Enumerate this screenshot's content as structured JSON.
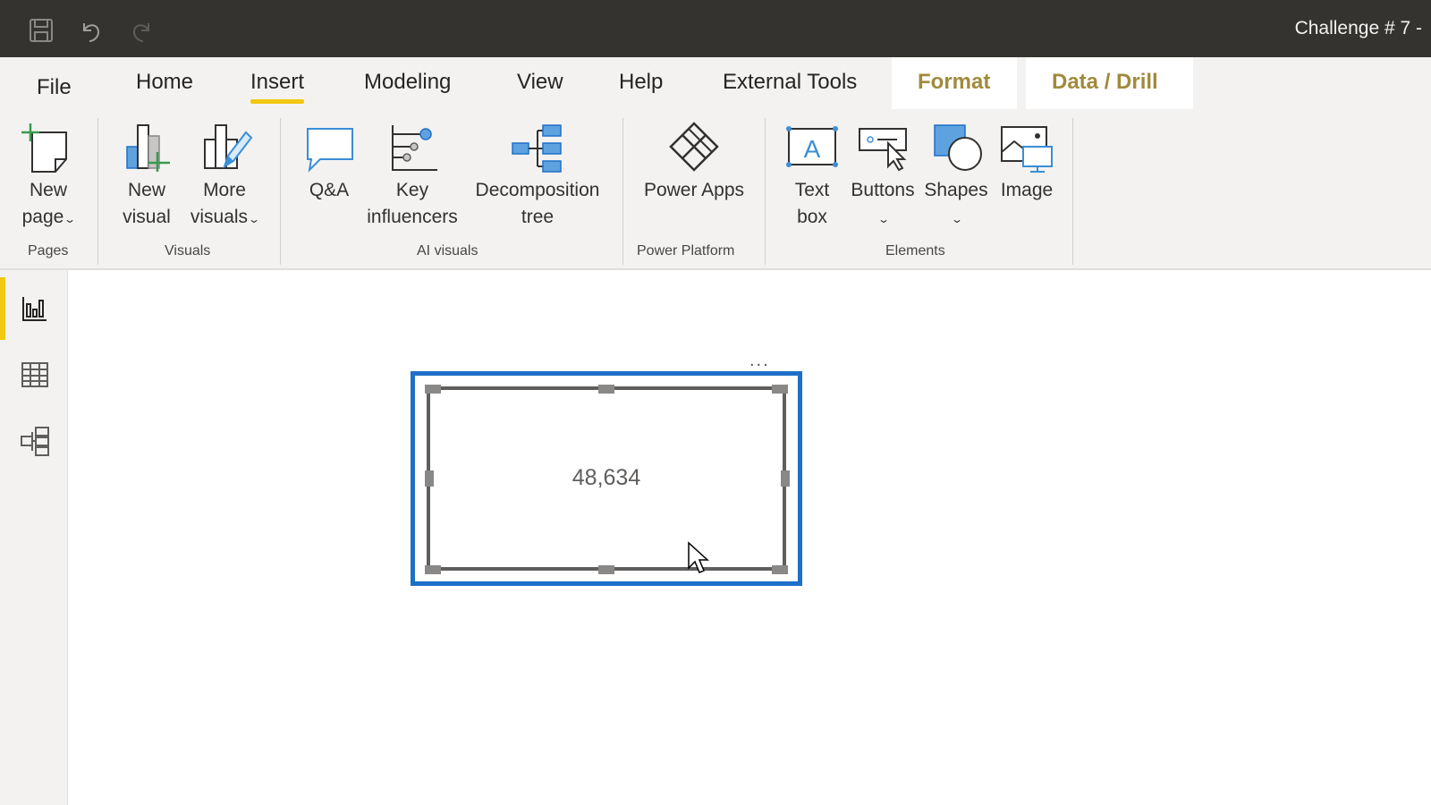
{
  "titlebar": {
    "title": "Challenge # 7 -",
    "quick_access": [
      {
        "name": "save-icon"
      },
      {
        "name": "undo-icon"
      },
      {
        "name": "redo-icon"
      }
    ]
  },
  "tabs": [
    {
      "label": "File"
    },
    {
      "label": "Home"
    },
    {
      "label": "Insert",
      "active": true
    },
    {
      "label": "Modeling"
    },
    {
      "label": "View"
    },
    {
      "label": "Help"
    },
    {
      "label": "External Tools"
    },
    {
      "label": "Format",
      "contextual": true
    },
    {
      "label": "Data / Drill",
      "contextual": true
    }
  ],
  "ribbon": {
    "groups": [
      {
        "label": "Pages",
        "buttons": [
          {
            "line1": "New",
            "line2": "page",
            "dropdown": true,
            "icon": "new-page-icon"
          }
        ]
      },
      {
        "label": "Visuals",
        "buttons": [
          {
            "line1": "New",
            "line2": "visual",
            "icon": "new-visual-icon"
          },
          {
            "line1": "More",
            "line2": "visuals",
            "dropdown": true,
            "icon": "more-visuals-icon"
          }
        ]
      },
      {
        "label": "AI visuals",
        "buttons": [
          {
            "line1": "Q&A",
            "line2": "",
            "icon": "qna-icon"
          },
          {
            "line1": "Key",
            "line2": "influencers",
            "icon": "key-influencers-icon"
          },
          {
            "line1": "Decomposition",
            "line2": "tree",
            "icon": "decomposition-tree-icon"
          }
        ]
      },
      {
        "label": "Power Platform",
        "buttons": [
          {
            "line1": "Power Apps",
            "line2": "",
            "icon": "power-apps-icon"
          }
        ]
      },
      {
        "label": "Elements",
        "buttons": [
          {
            "line1": "Text",
            "line2": "box",
            "icon": "text-box-icon"
          },
          {
            "line1": "Buttons",
            "line2": "",
            "dropdown": true,
            "icon": "buttons-icon"
          },
          {
            "line1": "Shapes",
            "line2": "",
            "dropdown": true,
            "icon": "shapes-icon"
          },
          {
            "line1": "Image",
            "line2": "",
            "icon": "image-icon"
          }
        ]
      }
    ]
  },
  "leftnav": {
    "items": [
      {
        "name": "report-view",
        "active": true
      },
      {
        "name": "data-view"
      },
      {
        "name": "model-view"
      }
    ]
  },
  "canvas": {
    "card_visual": {
      "value": "48,634",
      "more_options": "..."
    }
  },
  "colors": {
    "accent_yellow": "#f2c811",
    "selection_blue": "#1e6fc8",
    "contextual_tab": "#a08a3c",
    "titlebar": "#34332f"
  }
}
